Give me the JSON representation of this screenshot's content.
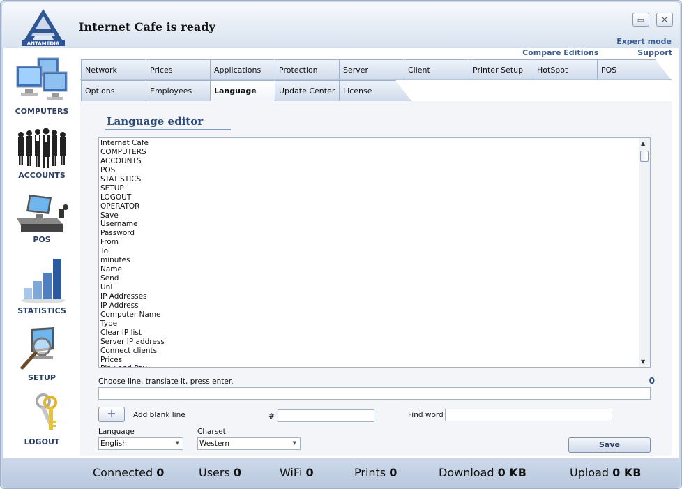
{
  "window": {
    "title": "Internet Cafe is ready",
    "logo_text": "ANTAMEDIA",
    "minimize": "▭",
    "close": "✕",
    "expert_mode": "Expert mode"
  },
  "links": {
    "compare": "Compare Editions",
    "support": "Support"
  },
  "sidebar": {
    "items": [
      {
        "label": "COMPUTERS",
        "icon": "computers-icon"
      },
      {
        "label": "ACCOUNTS",
        "icon": "accounts-icon"
      },
      {
        "label": "POS",
        "icon": "pos-icon"
      },
      {
        "label": "STATISTICS",
        "icon": "statistics-icon"
      },
      {
        "label": "SETUP",
        "icon": "setup-icon"
      },
      {
        "label": "LOGOUT",
        "icon": "logout-icon"
      }
    ]
  },
  "tabs": {
    "row1": [
      "Network",
      "Prices",
      "Applications",
      "Protection",
      "Server",
      "Client",
      "Printer Setup",
      "HotSpot",
      "POS"
    ],
    "row2": [
      "Options",
      "Employees",
      "Language",
      "Update Center",
      "License"
    ],
    "active": "Language"
  },
  "editor": {
    "title": "Language editor",
    "lines": [
      "Internet Cafe",
      "COMPUTERS",
      "ACCOUNTS",
      "POS",
      "STATISTICS",
      "SETUP",
      "LOGOUT",
      "OPERATOR",
      "Save",
      "Username",
      "Password",
      "From",
      "To",
      "minutes",
      "Name",
      "Send",
      "Unl",
      "IP Addresses",
      "IP Address",
      "Computer Name",
      "Type",
      "Clear IP list",
      "Server IP address",
      "Connect clients",
      "Prices",
      "Play and Pay"
    ],
    "hint": "Choose line, translate it, press enter.",
    "line_count": "0",
    "add_blank_line": "Add blank line",
    "plus": "+",
    "hash_label": "#",
    "find_word_label": "Find word",
    "language_label": "Language",
    "language_value": "English",
    "charset_label": "Charset",
    "charset_value": "Western",
    "save": "Save"
  },
  "status": {
    "connected_label": "Connected",
    "connected_value": "0",
    "users_label": "Users",
    "users_value": "0",
    "wifi_label": "WiFi",
    "wifi_value": "0",
    "prints_label": "Prints",
    "prints_value": "0",
    "download_label": "Download",
    "download_value": "0 KB",
    "upload_label": "Upload",
    "upload_value": "0 KB"
  },
  "colors": {
    "accent": "#3a5c94",
    "frame": "#cdd9ea",
    "panel": "#f3f5f8"
  }
}
